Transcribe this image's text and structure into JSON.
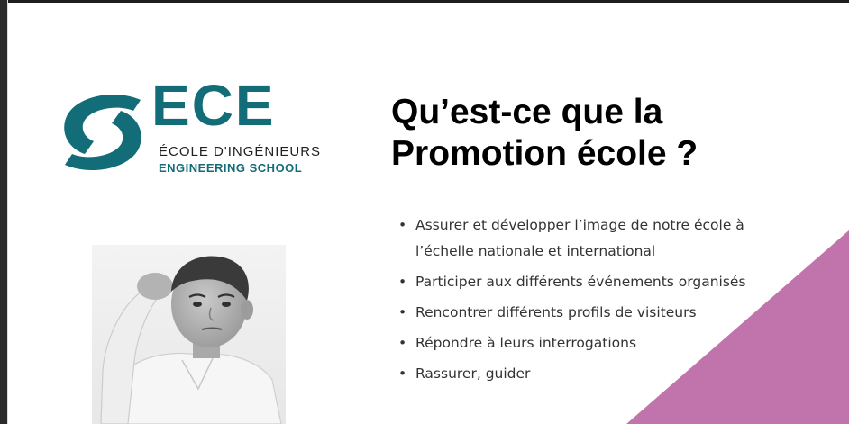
{
  "colors": {
    "brand_teal": "#126d78",
    "accent_pink": "#c174ab",
    "title": "#000000",
    "text": "#333333"
  },
  "logo": {
    "name": "ECE",
    "line1": "ÉCOLE D'INGÉNIEURS",
    "line2": "ENGINEERING SCHOOL"
  },
  "slide": {
    "title_line1": "Qu’est-ce que la",
    "title_line2": "Promotion école ?",
    "bullets": [
      "Assurer et développer l’image de notre école à l’échelle nationale et international",
      "Participer aux différents événements organisés",
      "Rencontrer différents profils de visiteurs",
      "Répondre à leurs interrogations",
      "Rassurer, guider"
    ]
  },
  "icons": {
    "logo_mark": "ece-swoosh-icon",
    "photo": "thinking-boy-photo"
  }
}
